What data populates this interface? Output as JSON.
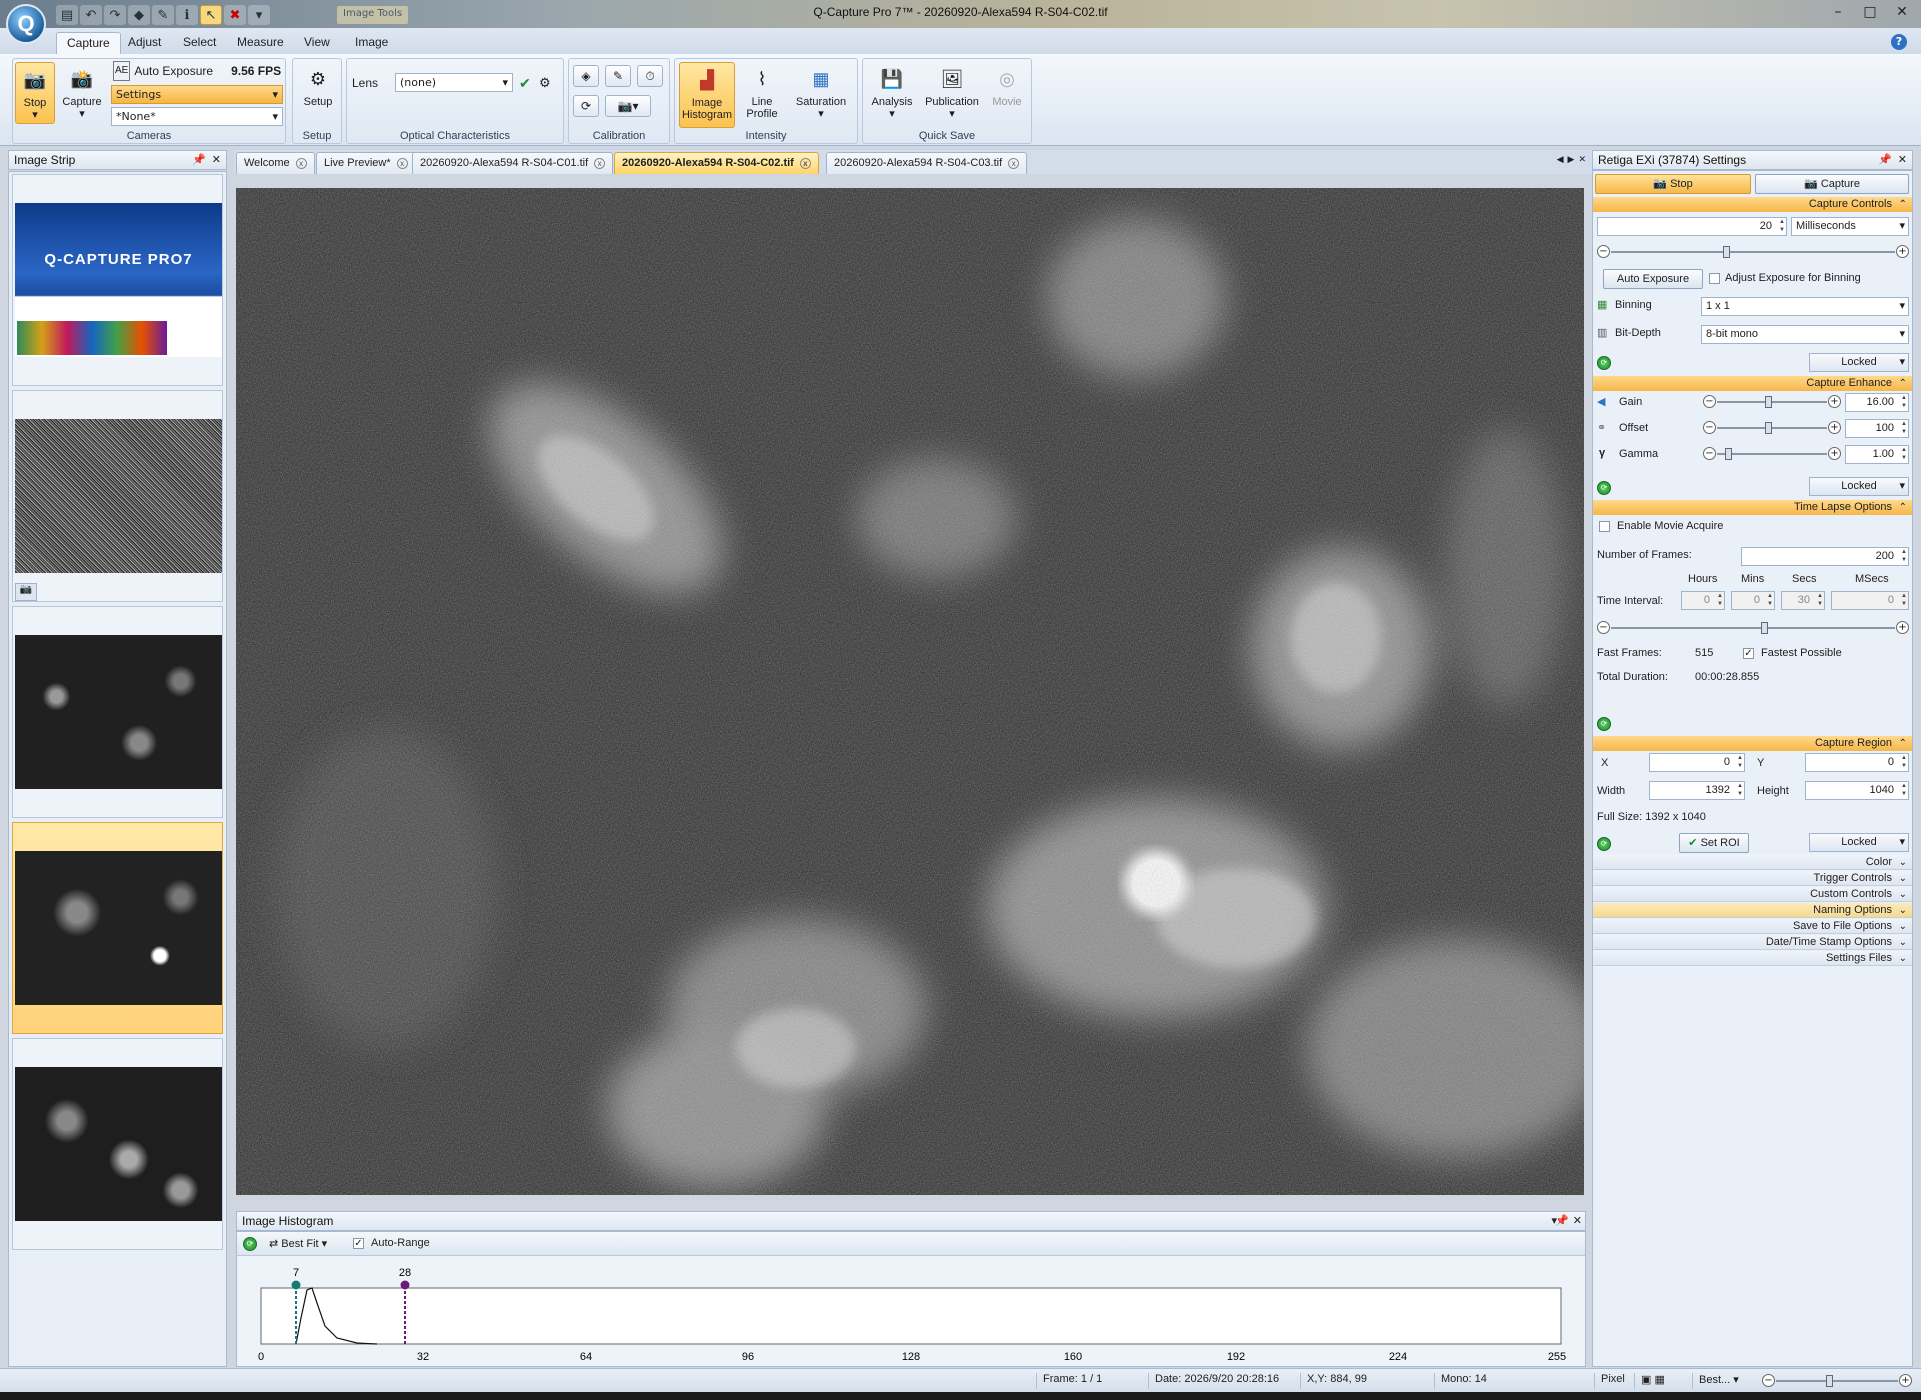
{
  "window": {
    "title": "Q-Capture Pro 7™ - 20260920-Alexa594 R-S04-C02.tif",
    "context_tab": "Image Tools"
  },
  "ribbon_tabs": [
    "Capture",
    "Adjust",
    "Select",
    "Measure",
    "View",
    "Image"
  ],
  "ribbon": {
    "cameras": {
      "stop": "Stop",
      "capture": "Capture",
      "auto_exposure": "Auto Exposure",
      "fps": "9.56 FPS",
      "settings": "Settings",
      "preset": "*None*",
      "label": "Cameras"
    },
    "setup": {
      "button": "Setup",
      "label": "Setup"
    },
    "optical": {
      "lens_label": "Lens",
      "lens_value": "(none)",
      "label": "Optical Characteristics"
    },
    "calibration": {
      "label": "Calibration"
    },
    "intensity": {
      "image_histogram": "Image Histogram",
      "line_profile": "Line Profile",
      "saturation": "Saturation",
      "label": "Intensity"
    },
    "quicksave": {
      "analysis": "Analysis",
      "publication": "Publication",
      "movie": "Movie",
      "label": "Quick Save"
    }
  },
  "image_strip": {
    "title": "Image Strip"
  },
  "doc_tabs": [
    {
      "label": "Welcome"
    },
    {
      "label": "Live Preview*"
    },
    {
      "label": "20260920-Alexa594 R-S04-C01.tif"
    },
    {
      "label": "20260920-Alexa594 R-S04-C02.tif"
    },
    {
      "label": "20260920-Alexa594 R-S04-C03.tif"
    }
  ],
  "histogram": {
    "title": "Image Histogram",
    "fit": "Best Fit",
    "auto_range": "Auto-Range",
    "low_marker": "7",
    "high_marker": "28",
    "axis_ticks": [
      "0",
      "32",
      "64",
      "96",
      "128",
      "160",
      "192",
      "224",
      "255"
    ]
  },
  "settings": {
    "title": "Retiga EXi (37874) Settings",
    "stop_btn": "Stop",
    "capture_btn": "Capture",
    "capture_controls": "Capture Controls",
    "exposure_value": "20",
    "exposure_unit": "Milliseconds",
    "auto_exposure": "Auto Exposure",
    "adjust_binning": "Adjust Exposure for Binning",
    "binning_label": "Binning",
    "binning_value": "1 x 1",
    "bitdepth_label": "Bit-Depth",
    "bitdepth_value": "8-bit mono",
    "locked": "Locked",
    "capture_enhance": "Capture Enhance",
    "gain_label": "Gain",
    "gain_value": "16.00",
    "offset_label": "Offset",
    "offset_value": "100",
    "gamma_label": "Gamma",
    "gamma_value": "1.00",
    "time_lapse": "Time Lapse Options",
    "enable_movie": "Enable Movie Acquire",
    "num_frames_label": "Number of Frames:",
    "num_frames": "200",
    "hours": "Hours",
    "mins": "Mins",
    "secs": "Secs",
    "msecs": "MSecs",
    "time_interval": "Time Interval:",
    "ti_hours": "0",
    "ti_mins": "0",
    "ti_secs": "30",
    "ti_msecs": "0",
    "fast_frames_label": "Fast Frames:",
    "fast_frames": "515",
    "fastest_possible": "Fastest Possible",
    "total_duration_label": "Total Duration:",
    "total_duration": "00:00:28.855",
    "capture_region": "Capture Region",
    "x_label": "X",
    "x_value": "0",
    "y_label": "Y",
    "y_value": "0",
    "width_label": "Width",
    "width_value": "1392",
    "height_label": "Height",
    "height_value": "1040",
    "full_size": "Full Size: 1392 x 1040",
    "set_roi": "Set ROI",
    "collapsed": [
      "Color",
      "Trigger Controls",
      "Custom Controls",
      "Naming Options",
      "Save to File Options",
      "Date/Time Stamp Options",
      "Settings Files"
    ]
  },
  "status": {
    "frame": "Frame: 1 / 1",
    "date": "Date: 2026/9/20 20:28:16",
    "xy": "X,Y:  884,   99",
    "mono": "Mono:   14",
    "unit": "Pixel",
    "zoom": "Best..."
  },
  "splash": {
    "brand": "Q-CAPTURE PRO7"
  }
}
